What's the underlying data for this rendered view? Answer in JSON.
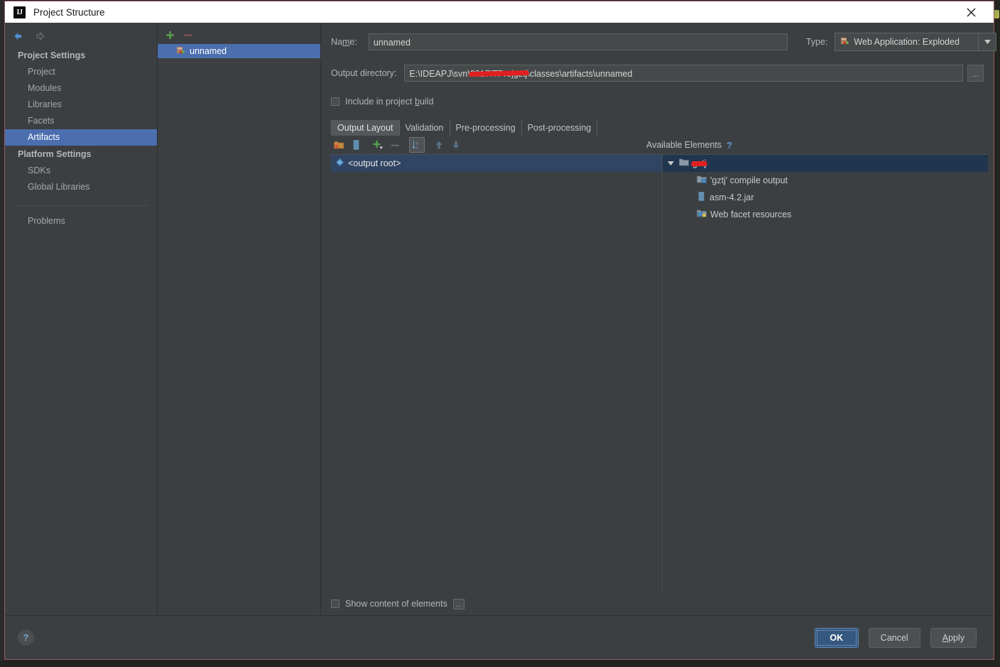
{
  "window": {
    "title": "Project Structure",
    "app_icon": "intellij-idea-logo",
    "close_icon": "close-icon"
  },
  "sidebar": {
    "back_icon": "arrow-left-icon",
    "forward_icon": "arrow-right-icon",
    "groups": [
      {
        "label": "Project Settings",
        "items": [
          {
            "label": "Project",
            "selected": false
          },
          {
            "label": "Modules",
            "selected": false
          },
          {
            "label": "Libraries",
            "selected": false
          },
          {
            "label": "Facets",
            "selected": false
          },
          {
            "label": "Artifacts",
            "selected": true
          }
        ]
      },
      {
        "label": "Platform Settings",
        "items": [
          {
            "label": "SDKs",
            "selected": false
          },
          {
            "label": "Global Libraries",
            "selected": false
          }
        ]
      }
    ],
    "problems_label": "Problems"
  },
  "artifact_list": {
    "toolbar": [
      {
        "name": "add-artifact-button",
        "icon": "plus-icon",
        "enabled": true
      },
      {
        "name": "remove-artifact-button",
        "icon": "minus-icon",
        "enabled": false
      }
    ],
    "items": [
      {
        "label": "unnamed",
        "icon": "web-application-icon",
        "selected": true
      }
    ]
  },
  "detail": {
    "name_label": "Name:",
    "name_mnemonic": "m",
    "name_value": "unnamed",
    "type_label": "Type:",
    "type_value": "Web Application: Exploded",
    "type_icon": "web-application-icon",
    "type_dropdown_icon": "chevron-down-icon",
    "output_dir_label": "Output directory:",
    "output_dir_value_prefix": "E:\\IDEAPJ\\svn\\",
    "output_dir_value_redacted": "2017ITProjgztj",
    "output_dir_value_suffix": "\\classes\\artifacts\\unnamed",
    "output_dir_browse_label": "...",
    "include_in_build_label_pre": "Include in project ",
    "include_in_build_label_mnemonic": "b",
    "include_in_build_label_post": "uild",
    "include_in_build_checked": false,
    "tabs": [
      {
        "label": "Output Layout",
        "active": true
      },
      {
        "label": "Validation",
        "active": false
      },
      {
        "label": "Pre-processing",
        "active": false
      },
      {
        "label": "Post-processing",
        "active": false
      }
    ],
    "layout_toolbar": [
      {
        "name": "create-directory-button",
        "icon": "folder-add-icon",
        "enabled": true,
        "pressed": false
      },
      {
        "name": "create-archive-button",
        "icon": "archive-icon",
        "enabled": true,
        "pressed": false
      },
      {
        "name": "add-copy-of-button",
        "icon": "plus-dropdown-icon",
        "enabled": true,
        "pressed": false
      },
      {
        "name": "remove-element-button",
        "icon": "minus-icon",
        "enabled": false,
        "pressed": false
      },
      {
        "name": "sort-elements-button",
        "icon": "sort-az-icon",
        "enabled": true,
        "pressed": true
      },
      {
        "name": "move-up-button",
        "icon": "arrow-up-icon",
        "enabled": false,
        "pressed": false
      },
      {
        "name": "move-down-button",
        "icon": "arrow-down-icon",
        "enabled": false,
        "pressed": false
      }
    ],
    "output_tree": [
      {
        "label": "<output root>",
        "icon": "output-root-icon",
        "selected": true
      }
    ],
    "available_elements": {
      "title": "Available Elements",
      "help_icon": "question-mark-icon",
      "nodes": [
        {
          "label": "gztj",
          "icon": "module-folder-icon",
          "indent": 0,
          "expanded": true,
          "selected": true,
          "redacted": true
        },
        {
          "label": "'gztj' compile output",
          "icon": "compile-output-icon",
          "indent": 1,
          "selected": false,
          "redacted": false
        },
        {
          "label": "asm-4.2.jar",
          "icon": "jar-icon",
          "indent": 1,
          "selected": false,
          "redacted": false
        },
        {
          "label": "Web facet resources",
          "icon": "web-facet-icon",
          "indent": 1,
          "selected": false,
          "redacted": false
        }
      ]
    },
    "show_content_label": "Show content of elements",
    "show_content_checked": false,
    "show_content_dots_label": "..."
  },
  "footer": {
    "help_icon": "question-mark-icon",
    "help_label": "?",
    "ok_label": "OK",
    "cancel_label": "Cancel",
    "apply_label_pre": "",
    "apply_label_mnemonic": "A",
    "apply_label_post": "pply"
  },
  "colors": {
    "accent_selection": "#4b6eaf",
    "panel_bg": "#3c3f41",
    "titlebar_bg": "#ffffff",
    "primary_button": "#365880",
    "redaction": "#e02020",
    "dialog_border": "#9c5a66"
  }
}
